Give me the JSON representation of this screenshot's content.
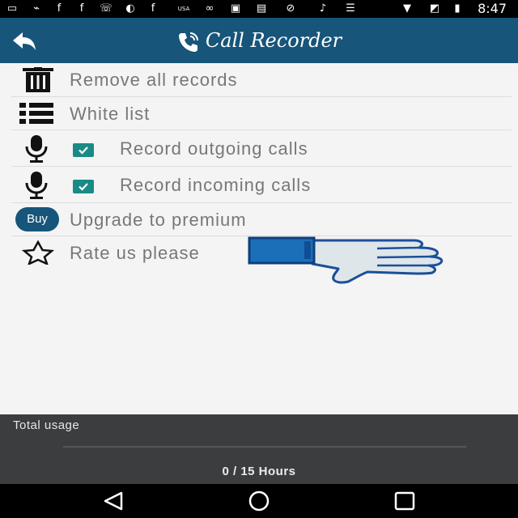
{
  "status_bar": {
    "time": "8:47",
    "icons": [
      "message-icon",
      "usb-icon",
      "facebook-icon",
      "caller-id-icon",
      "moon-icon",
      "facebook-icon",
      "usa-today-icon",
      "link-icon",
      "tape-icon",
      "no-music-icon",
      "guitar-icon",
      "playlist-icon",
      "wifi-icon",
      "no-sim-icon",
      "battery-charging-icon"
    ]
  },
  "app_bar": {
    "title": "Call Recorder",
    "back_icon": "back-arrow-icon"
  },
  "menu": {
    "items": [
      {
        "label": "Remove all records",
        "icon": "trash-icon"
      },
      {
        "label": "White list",
        "icon": "list-icon"
      },
      {
        "label": "Record outgoing calls",
        "icon": "microphone-icon",
        "checked": true
      },
      {
        "label": "Record incoming calls",
        "icon": "microphone-icon",
        "checked": true
      },
      {
        "label": "Upgrade to premium",
        "badge": "Buy"
      },
      {
        "label": "Rate us please",
        "icon": "star-outline-icon"
      }
    ]
  },
  "usage": {
    "label": "Total usage",
    "value": "0 / 15 Hours",
    "used": 0,
    "total": 15
  },
  "colors": {
    "app_bar": "#17557a",
    "checkbox": "#1a8a86",
    "usage_panel": "#3b3d3e",
    "thumb_blue": "#1b6fb8"
  }
}
